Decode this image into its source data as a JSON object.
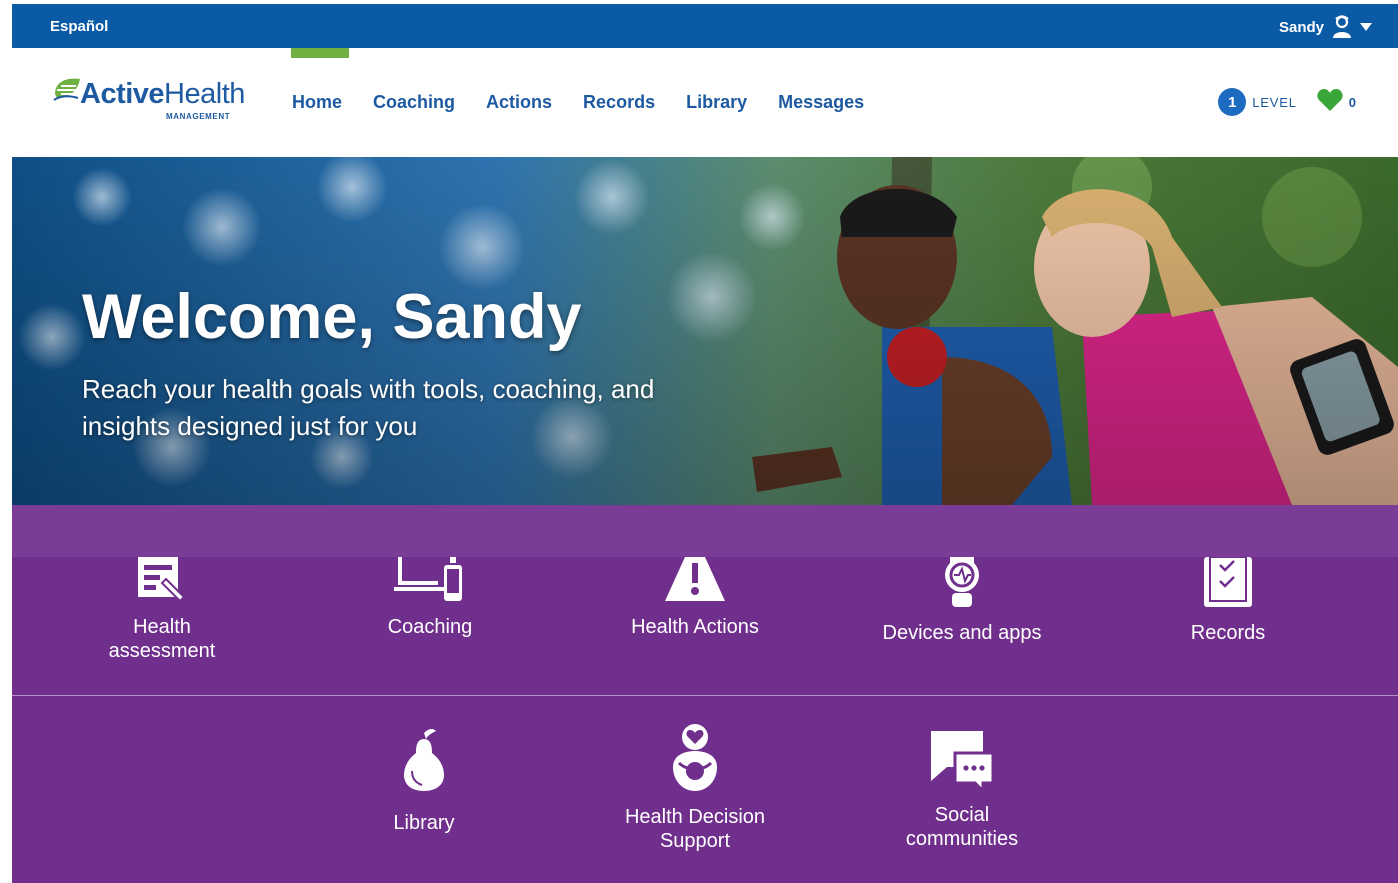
{
  "topbar": {
    "language_label": "Español",
    "user_name": "Sandy"
  },
  "brand": {
    "name_bold": "Active",
    "name_regular": "Health",
    "sub": "MANAGEMENT"
  },
  "nav": {
    "items": [
      {
        "label": "Home"
      },
      {
        "label": "Coaching"
      },
      {
        "label": "Actions"
      },
      {
        "label": "Records"
      },
      {
        "label": "Library"
      },
      {
        "label": "Messages"
      }
    ],
    "level_number": "1",
    "level_label": "LEVEL",
    "heart_count": "0"
  },
  "hero": {
    "title": "Welcome, Sandy",
    "subtitle": "Reach your health goals with tools, coaching, and insights designed just for you"
  },
  "tiles": {
    "row1": [
      {
        "label": "Health assessment",
        "icon": "health-assessment-icon"
      },
      {
        "label": "Coaching",
        "icon": "coaching-devices-icon"
      },
      {
        "label": "Health Actions",
        "icon": "warning-triangle-icon"
      },
      {
        "label": "Devices and apps",
        "icon": "smartwatch-icon"
      },
      {
        "label": "Records",
        "icon": "clipboard-checklist-icon"
      }
    ],
    "row2": [
      {
        "label": "Library",
        "icon": "pear-icon"
      },
      {
        "label": "Health Decision Support",
        "icon": "person-heart-icon"
      },
      {
        "label": "Social communities",
        "icon": "chat-bubbles-icon"
      }
    ]
  },
  "colors": {
    "topbar": "#0a5aa6",
    "brand_blue": "#1d5aa1",
    "accent_green": "#6fb043",
    "tiles_purple": "#702f8c"
  }
}
